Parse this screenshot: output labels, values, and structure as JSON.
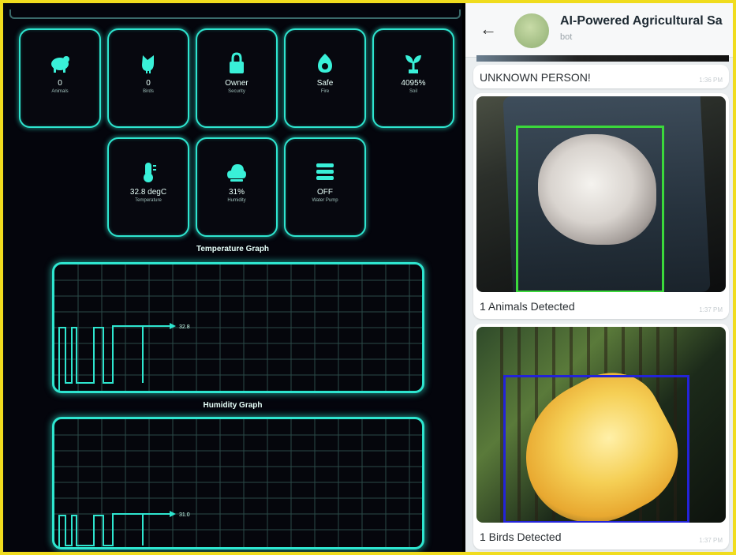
{
  "dashboard": {
    "sensors": [
      {
        "icon": "animal-icon",
        "value": "0",
        "label": "Animals"
      },
      {
        "icon": "bird-icon",
        "value": "0",
        "label": "Birds"
      },
      {
        "icon": "security-lock-icon",
        "value": "Owner",
        "label": "Security"
      },
      {
        "icon": "fire-icon",
        "value": "Safe",
        "label": "Fire"
      },
      {
        "icon": "soil-plant-icon",
        "value": "4095%",
        "label": "Soil"
      },
      {
        "icon": "thermometer-icon",
        "value": "32.8 degC",
        "label": "Temperature"
      },
      {
        "icon": "humidity-cloud-icon",
        "value": "31%",
        "label": "Humidity"
      },
      {
        "icon": "water-pump-icon",
        "value": "OFF",
        "label": "Water Pump"
      }
    ],
    "temperature_graph": {
      "title": "Temperature Graph",
      "current_label": "32.8",
      "color": "#2ee5cf"
    },
    "humidity_graph": {
      "title": "Humidity Graph",
      "current_label": "31.0",
      "color": "#2ee5cf"
    },
    "accent_color": "#2ee5cf"
  },
  "chat": {
    "title": "AI-Powered Agricultural Sa",
    "subtitle": "bot",
    "messages": [
      {
        "type": "text",
        "text": "UNKNOWN PERSON!",
        "time": "1:36 PM"
      },
      {
        "type": "photo",
        "caption": "1 Animals Detected",
        "time": "1:37 PM",
        "box_color": "#3bd83b",
        "subject": "cat"
      },
      {
        "type": "photo",
        "caption": "1 Birds Detected",
        "time": "1:37 PM",
        "box_color": "#2323d8",
        "subject": "bird"
      }
    ]
  }
}
